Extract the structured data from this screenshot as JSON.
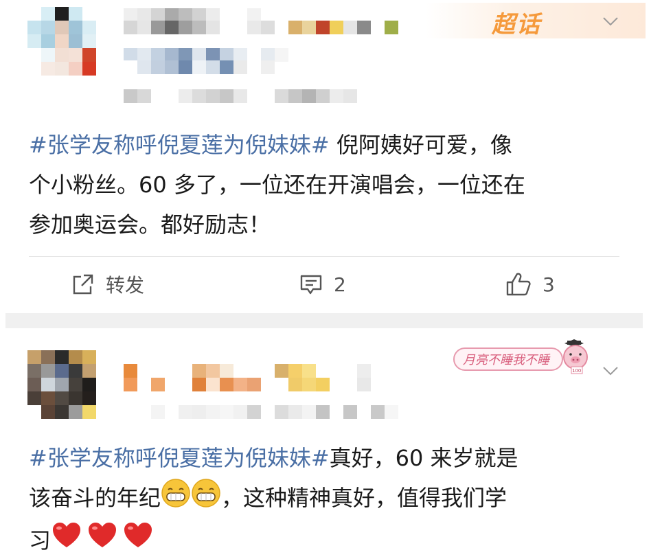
{
  "post1": {
    "badge_label": "超话",
    "content_tag": "#张学友称呼倪夏莲为倪妹妹#",
    "content_text_line1": " 倪阿姨好可爱，像",
    "content_text_line2": "个小粉丝。60 多了，一位还在开演唱会，一位还在",
    "content_text_line3": "参加奥运会。都好励志！",
    "actions": {
      "repost_label": "转发",
      "comment_count": "2",
      "like_count": "3"
    }
  },
  "post2": {
    "badge_label": "月亮不睡我不睡",
    "badge_sub": "100",
    "content_tag": "#张学友称呼倪夏莲为倪妹妹#",
    "content_text_line1": "真好，60 来岁就是",
    "content_text_line2a": "该奋斗的年纪",
    "content_text_line2b": "，这种精神真好，值得我们学",
    "content_text_line3": "习"
  },
  "icons": [
    "repost-icon",
    "comment-icon",
    "like-icon",
    "chevron-down-icon",
    "grin-emoji-icon",
    "heart-emoji-icon"
  ],
  "colors": {
    "hashtag": "#4a6fa5",
    "badge_orange": "#f59a3c",
    "text": "#1a1a1a",
    "action_text": "#555555",
    "separator": "#f0f0f0"
  }
}
